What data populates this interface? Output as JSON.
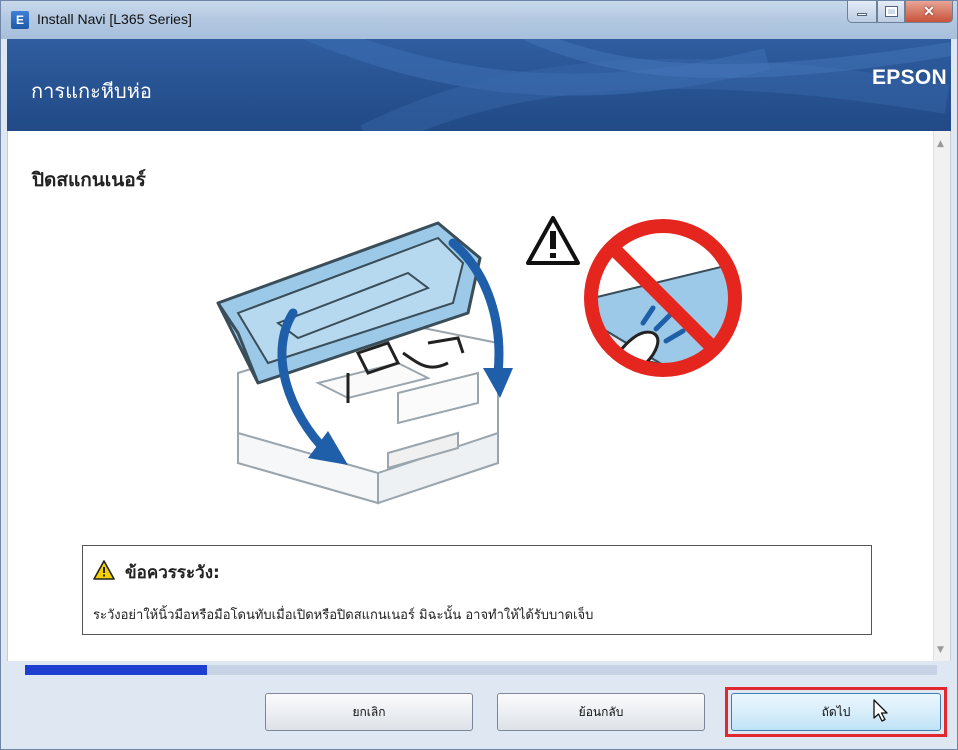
{
  "window": {
    "title": "Install Navi [L365 Series]",
    "icon_letter": "E",
    "close_glyph": "✕"
  },
  "header": {
    "title": "การแกะหีบห่อ",
    "brand": "EPSON"
  },
  "main": {
    "heading": "ปิดสแกนเนอร์",
    "caution": {
      "title": "ข้อควรระวัง:",
      "text": "ระวังอย่าให้นิ้วมือหรือมือโดนทับเมื่อเปิดหรือปิดสแกนเนอร์ มิฉะนั้น อาจทำให้ได้รับบาดเจ็บ"
    }
  },
  "progress": {
    "fraction": 0.2
  },
  "buttons": {
    "cancel": "ยกเลิก",
    "back": "ย้อนกลับ",
    "next": "ถัดไป"
  },
  "colors": {
    "header_bg": "#234d8c",
    "progress_fill": "#1f3fd0",
    "highlight": "#e0282e",
    "scanner_blue": "#9cc9e8",
    "prohibit_red": "#e5261f"
  }
}
